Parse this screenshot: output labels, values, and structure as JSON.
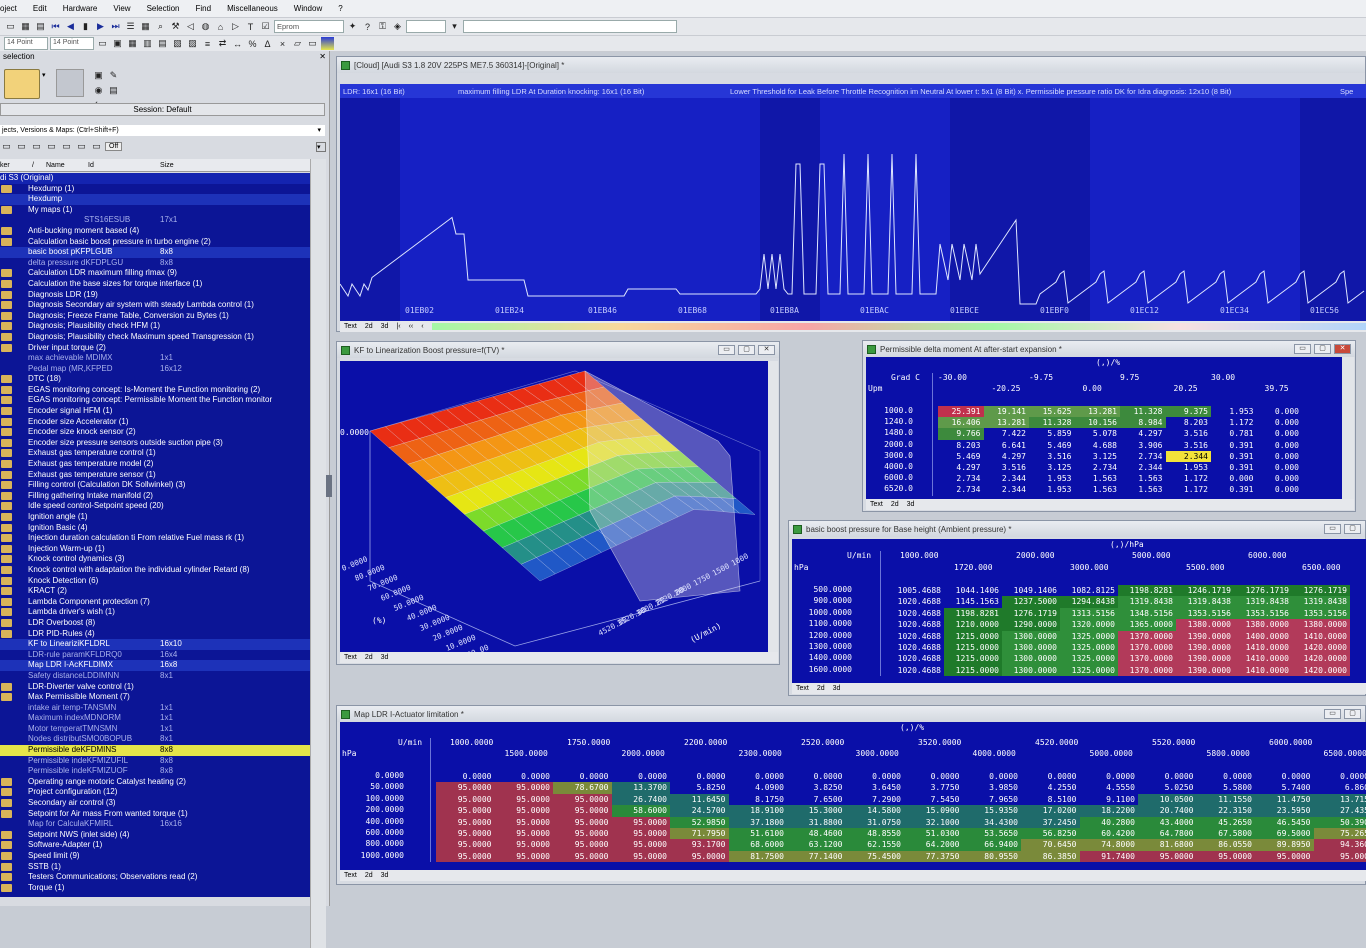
{
  "menu": [
    "oject",
    "Edit",
    "Hardware",
    "View",
    "Selection",
    "Find",
    "Miscellaneous",
    "Window",
    "?"
  ],
  "toolbar": {
    "eprom": "Eprom",
    "font1": "14 Point",
    "font2": "14 Point"
  },
  "sidebar": {
    "title": "selection",
    "session": "Session: Default",
    "projects_label": "jects, Versions & Maps: (Ctrl+Shift+F)",
    "off": "Off",
    "cols": [
      "ker",
      "/",
      "Name",
      "Id",
      "Size"
    ],
    "root": "di S3 (Original)",
    "items": [
      {
        "t": "Hexdump (1)",
        "s": "",
        "c": "f"
      },
      {
        "t": "Hexdump",
        "s": "",
        "c": "h"
      },
      {
        "t": "My maps (1)",
        "s": "",
        "c": "f"
      },
      {
        "t": "STS16ESUB",
        "s": "17x1",
        "c": "s2"
      },
      {
        "t": "Anti-bucking moment based (4)",
        "s": "",
        "c": "f"
      },
      {
        "t": "Calculation basic boost pressure in turbo engine (2)",
        "s": "",
        "c": "f"
      },
      {
        "t": "basic boost pKFPLGUB",
        "s": "8x8",
        "c": "h"
      },
      {
        "t": "delta pressure dKFDPLGU",
        "s": "8x8",
        "c": "s"
      },
      {
        "t": "Calculation LDR maximum filling rlmax (9)",
        "s": "",
        "c": "f"
      },
      {
        "t": "Calculation the base sizes for torque interface (1)",
        "s": "",
        "c": "f"
      },
      {
        "t": "Diagnosis LDR (19)",
        "s": "",
        "c": "f"
      },
      {
        "t": "Diagnosis Secondary air system with steady Lambda control (1)",
        "s": "",
        "c": "f"
      },
      {
        "t": "Diagnosis; Freeze Frame Table, Conversion zu Bytes (1)",
        "s": "",
        "c": "f"
      },
      {
        "t": "Diagnosis; Plausibility check HFM (1)",
        "s": "",
        "c": "f"
      },
      {
        "t": "Diagnosis; Plausibility check Maximum speed Transgression (1)",
        "s": "",
        "c": "f"
      },
      {
        "t": "Driver input torque (2)",
        "s": "",
        "c": "f"
      },
      {
        "t": "max achievable MDIMX",
        "s": "1x1",
        "c": "s"
      },
      {
        "t": "Pedal map (MR,KFPED",
        "s": "16x12",
        "c": "s"
      },
      {
        "t": "DTC (18)",
        "s": "",
        "c": "f"
      },
      {
        "t": "EGAS monitoring concept: Is-Moment the Function monitoring (2)",
        "s": "",
        "c": "f"
      },
      {
        "t": "EGAS monitoring concept: Permissible Moment the Function monitor",
        "s": "",
        "c": "f"
      },
      {
        "t": "Encoder signal HFM (1)",
        "s": "",
        "c": "f"
      },
      {
        "t": "Encoder size Accelerator (1)",
        "s": "",
        "c": "f"
      },
      {
        "t": "Encoder size knock sensor (2)",
        "s": "",
        "c": "f"
      },
      {
        "t": "Encoder size pressure sensors outside suction pipe (3)",
        "s": "",
        "c": "f"
      },
      {
        "t": "Exhaust gas temperature control (1)",
        "s": "",
        "c": "f"
      },
      {
        "t": "Exhaust gas temperature model (2)",
        "s": "",
        "c": "f"
      },
      {
        "t": "Exhaust gas temperature sensor (1)",
        "s": "",
        "c": "f"
      },
      {
        "t": "Filling control (Calculation DK Sollwinkel) (3)",
        "s": "",
        "c": "f"
      },
      {
        "t": "Filling gathering Intake manifold (2)",
        "s": "",
        "c": "f"
      },
      {
        "t": "Idle speed control-Setpoint speed (20)",
        "s": "",
        "c": "f"
      },
      {
        "t": "Ignition angle (1)",
        "s": "",
        "c": "f"
      },
      {
        "t": "Ignition Basic (4)",
        "s": "",
        "c": "f"
      },
      {
        "t": "Injection duration calculation ti From relative Fuel mass rk (1)",
        "s": "",
        "c": "f"
      },
      {
        "t": "Injection Warm-up (1)",
        "s": "",
        "c": "f"
      },
      {
        "t": "Knock control dynamics (3)",
        "s": "",
        "c": "f"
      },
      {
        "t": "Knock control with adaptation the individual cylinder Retard (8)",
        "s": "",
        "c": "f"
      },
      {
        "t": "Knock Detection (6)",
        "s": "",
        "c": "f"
      },
      {
        "t": "KRACT (2)",
        "s": "",
        "c": "f"
      },
      {
        "t": "Lambda Component protection (7)",
        "s": "",
        "c": "f"
      },
      {
        "t": "Lambda driver's wish (1)",
        "s": "",
        "c": "f"
      },
      {
        "t": "LDR Overboost (8)",
        "s": "",
        "c": "f"
      },
      {
        "t": "LDR PID-Rules (4)",
        "s": "",
        "c": "f"
      },
      {
        "t": "KF to LineariziKFLDRL",
        "s": "16x10",
        "c": "h"
      },
      {
        "t": "LDR-rule paramKFLDRQ0",
        "s": "16x4",
        "c": "s"
      },
      {
        "t": "Map LDR I-AcKFLDIMX",
        "s": "16x8",
        "c": "h"
      },
      {
        "t": "Safety distanceLDDIMNN",
        "s": "8x1",
        "c": "s"
      },
      {
        "t": "LDR-Diverter valve control (1)",
        "s": "",
        "c": "f"
      },
      {
        "t": "Max Permissible Moment (7)",
        "s": "",
        "c": "f"
      },
      {
        "t": "intake air temp-TANSMN",
        "s": "1x1",
        "c": "s"
      },
      {
        "t": "Maximum indexMDNORM",
        "s": "1x1",
        "c": "s"
      },
      {
        "t": "Motor temperatTMNSMN",
        "s": "1x1",
        "c": "s"
      },
      {
        "t": "Nodes distributSMO0BOPUB",
        "s": "8x1",
        "c": "s"
      },
      {
        "t": "Permissible deKFDMINS",
        "s": "8x8",
        "c": "y"
      },
      {
        "t": "Permissible indeKFMIZUFIL",
        "s": "8x8",
        "c": "s"
      },
      {
        "t": "Permissible indeKFMIZUOF",
        "s": "8x8",
        "c": "s"
      },
      {
        "t": "Operating range motoric Catalyst heating (2)",
        "s": "",
        "c": "f"
      },
      {
        "t": "Project configuration (12)",
        "s": "",
        "c": "f"
      },
      {
        "t": "Secondary air control (3)",
        "s": "",
        "c": "f"
      },
      {
        "t": "Setpoint for Air mass From wanted torque (1)",
        "s": "",
        "c": "f"
      },
      {
        "t": "Map for CalculaKFMIRL",
        "s": "16x16",
        "c": "s"
      },
      {
        "t": "Setpoint NWS (inlet side) (4)",
        "s": "",
        "c": "f"
      },
      {
        "t": "Software-Adapter (1)",
        "s": "",
        "c": "f"
      },
      {
        "t": "Speed limit (9)",
        "s": "",
        "c": "f"
      },
      {
        "t": "SSTB (1)",
        "s": "",
        "c": "f"
      },
      {
        "t": "Testers Communications; Observations read (2)",
        "s": "",
        "c": "f"
      },
      {
        "t": "Torque (1)",
        "s": "",
        "c": "f"
      }
    ]
  },
  "hexwin": {
    "title": "[Cloud] [Audi S3 1.8 20V 225PS ME7.5 360314]-[Original] *",
    "labels": [
      "LDR: 16x1 (16 Bit)",
      "maximum filling LDR At Duration knocking: 16x1 (16 Bit)",
      "Lower Threshold for Leak Before Throttle Recognition im Neutral At lower t: 5x1 (8 Bit) x. Permissible pressure ratio DK for Idra diagnosis: 12x10 (8 Bit)",
      "Spe"
    ],
    "addresses": [
      "01EB02",
      "01EB24",
      "01EB46",
      "01EB68",
      "01EB8A",
      "01EBAC",
      "01EBCE",
      "01EBF0",
      "01EC12",
      "01EC34",
      "01EC56"
    ],
    "tabs": [
      "Text",
      "2d",
      "3d"
    ]
  },
  "win3d": {
    "title": "KF to Linearization Boost pressure=f(TV) *",
    "zlabel": "0.0000",
    "left_ticks": [
      "0.0000",
      "80.0000",
      "70.0000",
      "60.0000",
      "50.0000",
      "40.0000",
      "30.0000",
      "20.0000",
      "10.0000",
      "6500.00"
    ],
    "unit_left": "(%)",
    "unit_right": "(U/min)",
    "right_ticks": [
      "4520.00",
      "3520.00",
      "3000.00",
      "2520.00",
      "2000",
      "1750",
      "1500",
      "1000"
    ],
    "tabs": [
      "Text",
      "2d",
      "3d"
    ]
  },
  "winDM": {
    "title": "Permissible delta moment At after-start expansion *",
    "unit_top": "(,)/%",
    "corner1": "Grad C",
    "corner2": "Upm",
    "cols_a": [
      "-30.00",
      "-9.75",
      "9.75",
      "30.00"
    ],
    "cols_b": [
      "-20.25",
      "0.00",
      "20.25",
      "39.75"
    ],
    "rows": [
      "1000.0",
      "1240.0",
      "1480.0",
      "2000.0",
      "3000.0",
      "4000.0",
      "6000.0",
      "6520.0"
    ],
    "cells": [
      [
        "25.391",
        "19.141",
        "15.625",
        "13.281",
        "11.328",
        "9.375",
        "1.953",
        "0.000"
      ],
      [
        "16.406",
        "13.281",
        "11.328",
        "10.156",
        "8.984",
        "8.203",
        "1.172",
        "0.000"
      ],
      [
        "9.766",
        "7.422",
        "5.859",
        "5.078",
        "4.297",
        "3.516",
        "0.781",
        "0.000"
      ],
      [
        "8.203",
        "6.641",
        "5.469",
        "4.688",
        "3.906",
        "3.516",
        "0.391",
        "0.000"
      ],
      [
        "5.469",
        "4.297",
        "3.516",
        "3.125",
        "2.734",
        "2.344",
        "0.391",
        "0.000"
      ],
      [
        "4.297",
        "3.516",
        "3.125",
        "2.734",
        "2.344",
        "1.953",
        "0.391",
        "0.000"
      ],
      [
        "2.734",
        "2.344",
        "1.953",
        "1.563",
        "1.563",
        "1.172",
        "0.000",
        "0.000"
      ],
      [
        "2.734",
        "2.344",
        "1.953",
        "1.563",
        "1.563",
        "1.172",
        "0.391",
        "0.000"
      ]
    ],
    "tabs": [
      "Text",
      "2d",
      "3d"
    ]
  },
  "winBB": {
    "title": "basic boost pressure for Base height (Ambient pressure) *",
    "unit_top": "(,)/hPa",
    "corner1": "U/min",
    "corner2": "hPa",
    "cols_a": [
      "1000.000",
      "2000.000",
      "5000.000",
      "6000.000"
    ],
    "cols_b": [
      "1720.000",
      "3000.000",
      "5500.000",
      "6500.000"
    ],
    "rows": [
      "500.0000",
      "900.0000",
      "1000.0000",
      "1100.0000",
      "1200.0000",
      "1300.0000",
      "1400.0000",
      "1600.0000"
    ],
    "cells": [
      [
        "1005.4688",
        "1044.1406",
        "1049.1406",
        "1082.8125",
        "1198.8281",
        "1246.1719",
        "1276.1719",
        "1276.1719"
      ],
      [
        "1020.4688",
        "1145.1563",
        "1237.5000",
        "1294.8438",
        "1319.8438",
        "1319.8438",
        "1319.8438",
        "1319.8438"
      ],
      [
        "1020.4688",
        "1198.8281",
        "1276.1719",
        "1313.5156",
        "1348.5156",
        "1353.5156",
        "1353.5156",
        "1353.5156"
      ],
      [
        "1020.4688",
        "1210.0000",
        "1290.0000",
        "1320.0000",
        "1365.0000",
        "1380.0000",
        "1380.0000",
        "1380.0000"
      ],
      [
        "1020.4688",
        "1215.0000",
        "1300.0000",
        "1325.0000",
        "1370.0000",
        "1390.0000",
        "1400.0000",
        "1410.0000"
      ],
      [
        "1020.4688",
        "1215.0000",
        "1300.0000",
        "1325.0000",
        "1370.0000",
        "1390.0000",
        "1410.0000",
        "1420.0000"
      ],
      [
        "1020.4688",
        "1215.0000",
        "1300.0000",
        "1325.0000",
        "1370.0000",
        "1390.0000",
        "1410.0000",
        "1420.0000"
      ],
      [
        "1020.4688",
        "1215.0000",
        "1300.0000",
        "1325.0000",
        "1370.0000",
        "1390.0000",
        "1410.0000",
        "1420.0000"
      ]
    ],
    "tabs": [
      "Text",
      "2d",
      "3d"
    ]
  },
  "winLDR": {
    "title": "Map LDR I-Actuator limitation *",
    "unit_top": "(,)/%",
    "corner1": "U/min",
    "corner2": "hPa",
    "cols_a": [
      "1000.0000",
      "1750.0000",
      "2200.0000",
      "2520.0000",
      "3520.0000",
      "4520.0000",
      "5520.0000",
      "6000.0000"
    ],
    "cols_b": [
      "1500.0000",
      "2000.0000",
      "2300.0000",
      "3000.0000",
      "4000.0000",
      "5000.0000",
      "5800.0000",
      "6500.0000"
    ],
    "rows": [
      "0.0000",
      "50.0000",
      "100.0000",
      "200.0000",
      "400.0000",
      "600.0000",
      "800.0000",
      "1000.0000"
    ],
    "cells": [
      [
        "0.0000",
        "0.0000",
        "0.0000",
        "0.0000",
        "0.0000",
        "0.0000",
        "0.0000",
        "0.0000",
        "0.0000",
        "0.0000",
        "0.0000",
        "0.0000",
        "0.0000",
        "0.0000",
        "0.0000",
        "0.0000"
      ],
      [
        "95.0000",
        "95.0000",
        "78.6700",
        "13.3700",
        "5.8250",
        "4.0900",
        "3.8250",
        "3.6450",
        "3.7750",
        "3.9850",
        "4.2550",
        "4.5550",
        "5.0250",
        "5.5800",
        "5.7400",
        "6.860"
      ],
      [
        "95.0000",
        "95.0000",
        "95.0000",
        "26.7400",
        "11.6450",
        "8.1750",
        "7.6500",
        "7.2900",
        "7.5450",
        "7.9650",
        "8.5100",
        "9.1100",
        "10.0500",
        "11.1550",
        "11.4750",
        "13.715"
      ],
      [
        "95.0000",
        "95.0000",
        "95.0000",
        "58.6000",
        "24.5700",
        "18.9100",
        "15.3000",
        "14.5800",
        "15.0900",
        "15.9350",
        "17.0200",
        "18.2200",
        "20.7400",
        "22.3150",
        "23.5950",
        "27.435"
      ],
      [
        "95.0000",
        "95.0000",
        "95.0000",
        "95.0000",
        "52.9850",
        "37.1800",
        "31.8800",
        "31.0750",
        "32.1000",
        "34.4300",
        "37.2450",
        "40.2800",
        "43.4000",
        "45.2650",
        "46.5450",
        "50.390"
      ],
      [
        "95.0000",
        "95.0000",
        "95.0000",
        "95.0000",
        "71.7950",
        "51.6100",
        "48.4600",
        "48.8550",
        "51.0300",
        "53.5650",
        "56.8250",
        "60.4200",
        "64.7800",
        "67.5800",
        "69.5000",
        "75.265"
      ],
      [
        "95.0000",
        "95.0000",
        "95.0000",
        "95.0000",
        "93.1700",
        "68.6000",
        "63.1200",
        "62.1550",
        "64.2000",
        "66.9400",
        "70.6450",
        "74.8000",
        "81.6800",
        "86.0550",
        "89.8950",
        "94.360"
      ],
      [
        "95.0000",
        "95.0000",
        "95.0000",
        "95.0000",
        "95.0000",
        "81.7500",
        "77.1400",
        "75.4500",
        "77.3750",
        "80.9550",
        "86.3850",
        "91.7400",
        "95.0000",
        "95.0000",
        "95.0000",
        "95.000"
      ]
    ],
    "tabs": [
      "Text",
      "2d",
      "3d"
    ]
  },
  "colors": {
    "cell_blue": "#0a0fa8",
    "tree_bg": "#0c1596",
    "highlight_yellow": "#e5e54a"
  }
}
